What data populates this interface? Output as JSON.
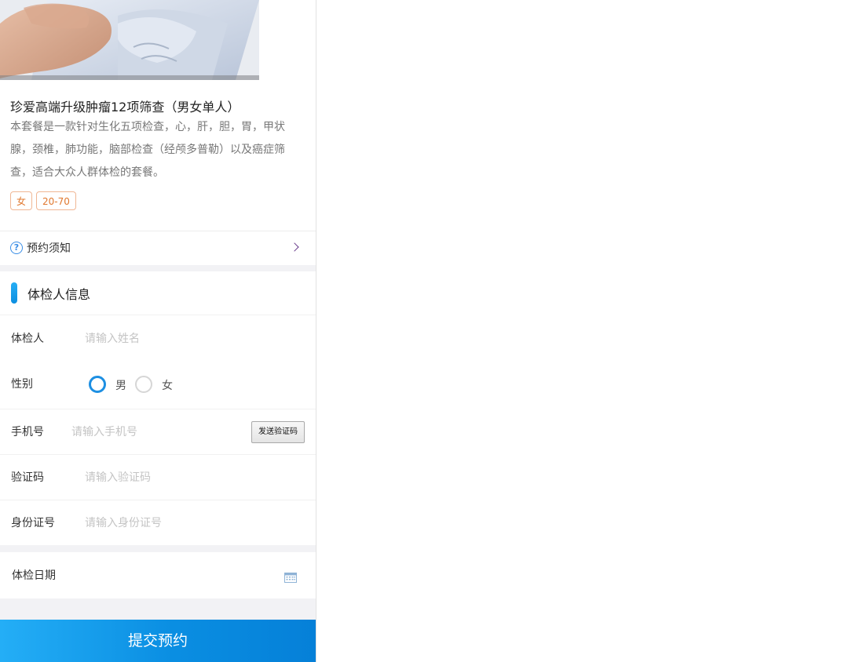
{
  "hero": {
    "image": "person-crossed-arms-photo"
  },
  "package": {
    "title": "珍爱高端升级肿瘤12项筛查（男女单人）",
    "description": "本套餐是一款针对生化五项检查，心，肝，胆，胃，甲状腺，颈椎，肺功能，脑部检查（经颅多普勒）以及癌症筛查，适合大众人群体检的套餐。",
    "tags": [
      "女",
      "20-70"
    ]
  },
  "notice": {
    "icon": "question-circle-icon",
    "label": "预约须知",
    "arrow": "chevron-right-icon"
  },
  "section": {
    "title": "体检人信息"
  },
  "form": {
    "name": {
      "label": "体检人",
      "placeholder": "请输入姓名"
    },
    "gender": {
      "label": "性别",
      "options": [
        "男",
        "女"
      ],
      "selected": "男"
    },
    "phone": {
      "label": "手机号",
      "placeholder": "请输入手机号",
      "send_code": "发送验证码"
    },
    "code": {
      "label": "验证码",
      "placeholder": "请输入验证码"
    },
    "id_card": {
      "label": "身份证号",
      "placeholder": "请输入身份证号"
    },
    "date": {
      "label": "体检日期",
      "icon": "calendar-icon"
    }
  },
  "submit": {
    "label": "提交预约"
  },
  "colors": {
    "accent": "#1d8fe2",
    "tag": "#e0782f",
    "submit_start": "#24aef6",
    "submit_end": "#0580d8"
  }
}
